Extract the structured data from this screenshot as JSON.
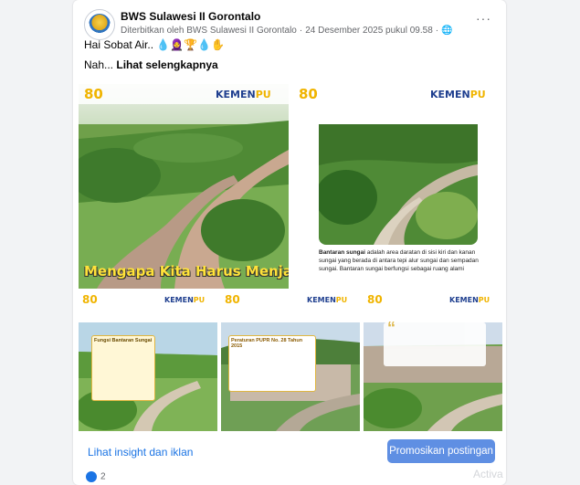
{
  "post": {
    "page_name": "BWS Sulawesi II Gorontalo",
    "published_by": "Diterbitkan oleh BWS Sulawesi II Gorontalo",
    "date": "24 Desember 2025 pukul 09.58",
    "more_icon": "more-horizontal-icon",
    "globe_icon": "globe-icon",
    "greeting": "Hai Sobat Air..",
    "greeting_emojis": "💧🧕🏆💧✋",
    "text_prefix": "Nah... ",
    "see_more": "Lihat selengkapnya"
  },
  "images": {
    "logo_number": "80",
    "kemen": "KEMEN",
    "pu": "PU",
    "tile1_caption": "Mengapa Kita Harus Menjaga",
    "tile2_bold": "Bantaran sungai",
    "tile2_text": "adalah area daratan di sisi kiri dan kanan sungai yang berada di antara tepi alur sungai dan sempadan sungai. Bantaran sungai berfungsi sebagai ruang alami",
    "tile3_title": "Fungsi Bantaran Sungai",
    "tile4_title": "Peraturan PUPR No. 28 Tahun 2015"
  },
  "actions": {
    "insight": "Lihat insight dan iklan",
    "promote": "Promosikan postingan"
  },
  "reactions": {
    "count": "2",
    "like_icon": "like-icon"
  },
  "watermark": "Activa"
}
